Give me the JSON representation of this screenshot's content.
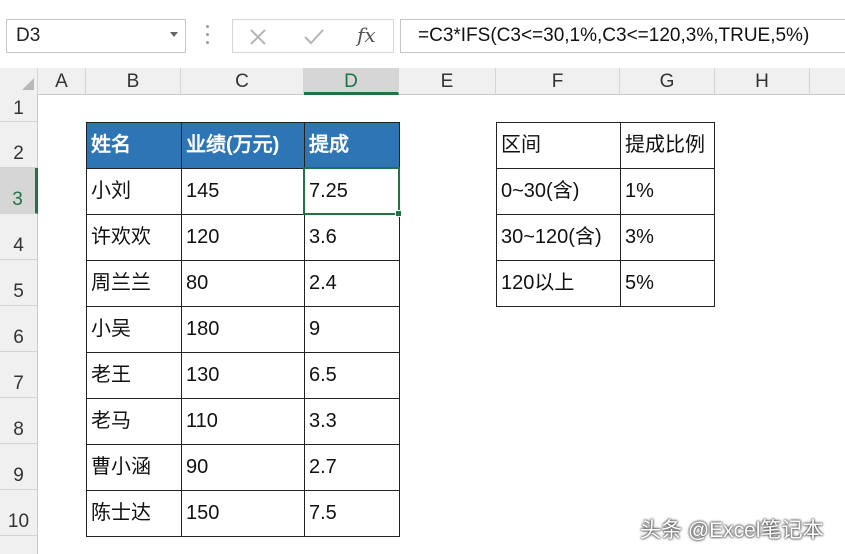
{
  "name_box": "D3",
  "formula": "=C3*IFS(C3<=30,1%,C3<=120,3%,TRUE,5%)",
  "icons": {
    "cancel": "close-icon",
    "enter": "check-icon",
    "function": "fx-icon"
  },
  "fx_label": "fx",
  "columns": [
    "A",
    "B",
    "C",
    "D",
    "E",
    "F",
    "G",
    "H"
  ],
  "rows": [
    "1",
    "2",
    "3",
    "4",
    "5",
    "6",
    "7",
    "8",
    "9",
    "10"
  ],
  "selected_column": "D",
  "selected_row": "3",
  "main_table": {
    "headers": [
      "姓名",
      "业绩(万元)",
      "提成"
    ],
    "rows": [
      [
        "小刘",
        "145",
        "7.25"
      ],
      [
        "许欢欢",
        "120",
        "3.6"
      ],
      [
        "周兰兰",
        "80",
        "2.4"
      ],
      [
        "小吴",
        "180",
        "9"
      ],
      [
        "老王",
        "130",
        "6.5"
      ],
      [
        "老马",
        "110",
        "3.3"
      ],
      [
        "曹小涵",
        "90",
        "2.7"
      ],
      [
        "陈士达",
        "150",
        "7.5"
      ]
    ]
  },
  "rate_table": {
    "headers": [
      "区间",
      "提成比例"
    ],
    "rows": [
      [
        "0~30(含)",
        "1%"
      ],
      [
        "30~120(含)",
        "3%"
      ],
      [
        "120以上",
        "5%"
      ]
    ]
  },
  "watermark": "头条 @Excel笔记本",
  "colors": {
    "header_fill": "#2e75b6",
    "selection": "#217346"
  }
}
